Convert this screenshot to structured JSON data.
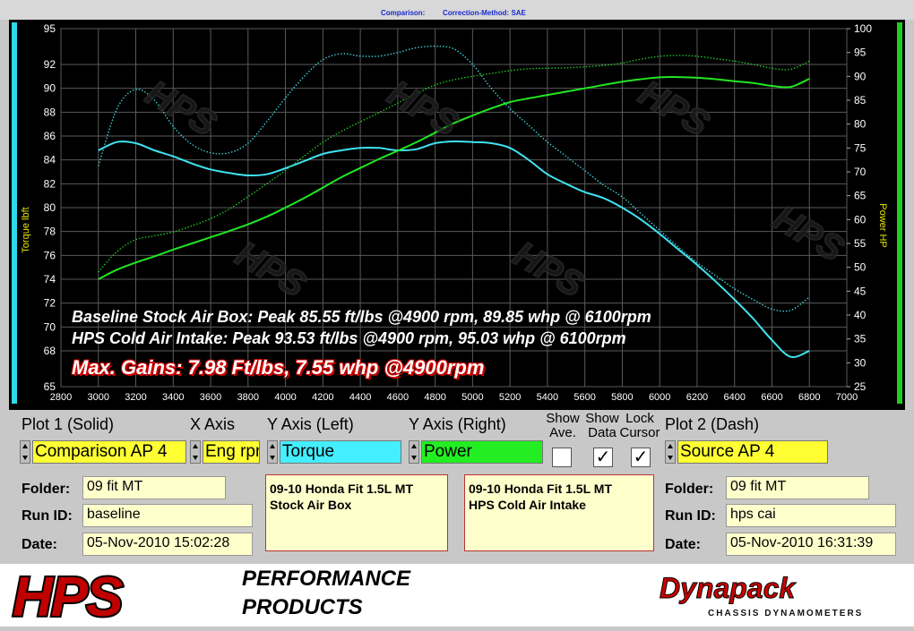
{
  "header": {
    "comparison_label": "Comparison:",
    "correction_label": "Correction-Method: SAE"
  },
  "chart_data": {
    "type": "line",
    "x": [
      3000,
      3100,
      3200,
      3300,
      3400,
      3500,
      3600,
      3700,
      3800,
      3900,
      4000,
      4100,
      4200,
      4300,
      4400,
      4500,
      4600,
      4700,
      4800,
      4900,
      5000,
      5100,
      5200,
      5300,
      5400,
      5500,
      5600,
      5700,
      5800,
      5900,
      6000,
      6100,
      6200,
      6300,
      6400,
      6500,
      6600,
      6700,
      6800
    ],
    "xlim": [
      2800,
      7000
    ],
    "x_ticks": [
      "2800",
      "3000",
      "3200",
      "3400",
      "3600",
      "3800",
      "4000",
      "4200",
      "4400",
      "4600",
      "4800",
      "5000",
      "5200",
      "5400",
      "5600",
      "5800",
      "6000",
      "6200",
      "6400",
      "6600",
      "6800",
      "7000"
    ],
    "ylabel": "Torque lbft",
    "ylim": [
      65,
      95
    ],
    "y_ticks": [
      "65",
      "68",
      "70",
      "72",
      "74",
      "76",
      "78",
      "80",
      "82",
      "84",
      "86",
      "88",
      "90",
      "92",
      "95"
    ],
    "y2label": "Power HP",
    "y2lim": [
      25,
      100
    ],
    "y2_ticks": [
      "25",
      "30",
      "35",
      "40",
      "45",
      "50",
      "55",
      "60",
      "65",
      "70",
      "75",
      "80",
      "85",
      "90",
      "95",
      "100"
    ],
    "grid": true,
    "series": [
      {
        "axis": "left",
        "style": "solid",
        "color": "#3fe3f0",
        "values": [
          84.8,
          85.5,
          85.4,
          84.8,
          84.3,
          83.7,
          83.2,
          82.9,
          82.7,
          82.8,
          83.3,
          83.9,
          84.5,
          84.8,
          85.0,
          85.0,
          84.8,
          84.9,
          85.4,
          85.55,
          85.5,
          85.4,
          85.0,
          84.0,
          82.8,
          82.0,
          81.3,
          80.8,
          80.0,
          79.0,
          77.8,
          76.5,
          75.2,
          73.8,
          72.3,
          70.7,
          68.9,
          67.5,
          68.0
        ]
      },
      {
        "axis": "right",
        "style": "solid",
        "color": "#22e622",
        "values": [
          47.5,
          49.5,
          51.0,
          52.3,
          53.7,
          55.0,
          56.3,
          57.6,
          59.0,
          60.6,
          62.5,
          64.5,
          66.7,
          68.9,
          70.8,
          72.7,
          74.4,
          76.2,
          78.2,
          80.2,
          81.8,
          83.3,
          84.6,
          85.4,
          86.1,
          86.8,
          87.5,
          88.2,
          88.9,
          89.4,
          89.8,
          89.85,
          89.7,
          89.4,
          89.0,
          88.6,
          88.0,
          87.8,
          89.5
        ]
      },
      {
        "axis": "left",
        "style": "dotted",
        "color": "#3fd8e0",
        "values": [
          83.5,
          88.3,
          89.9,
          89.0,
          86.8,
          85.3,
          84.6,
          84.6,
          85.4,
          87.2,
          89.2,
          91.0,
          92.4,
          92.9,
          92.7,
          92.7,
          93.0,
          93.4,
          93.53,
          93.3,
          92.0,
          90.0,
          88.3,
          86.9,
          85.5,
          84.3,
          83.1,
          81.9,
          80.9,
          79.5,
          78.1,
          76.7,
          75.4,
          74.3,
          73.2,
          72.3,
          71.5,
          71.4,
          72.5
        ]
      },
      {
        "axis": "right",
        "style": "dotted",
        "color": "#22d022",
        "values": [
          49.0,
          53.3,
          55.8,
          56.6,
          57.4,
          58.7,
          60.2,
          62.2,
          64.8,
          67.5,
          70.3,
          73.3,
          76.2,
          78.5,
          80.5,
          82.4,
          84.4,
          86.4,
          88.2,
          89.3,
          90.0,
          90.6,
          91.2,
          91.6,
          91.7,
          91.8,
          92.0,
          92.3,
          92.8,
          93.6,
          94.2,
          94.4,
          94.2,
          93.7,
          93.2,
          92.5,
          91.7,
          91.5,
          93.2
        ]
      }
    ]
  },
  "annotations": {
    "line1": "Baseline Stock Air Box: Peak 85.55 ft/lbs @4900 rpm, 89.85 whp @ 6100rpm",
    "line2": "HPS Cold Air Intake: Peak 93.53 ft/lbs @4900 rpm, 95.03 whp @ 6100rpm",
    "line3": "Max. Gains:  7.98 Ft/lbs, 7.55 whp @4900rpm"
  },
  "panel": {
    "plot1_label": "Plot 1 (Solid)",
    "xaxis_label": "X Axis",
    "yleft_label": "Y Axis (Left)",
    "yright_label": "Y Axis (Right)",
    "show_ave_label": "Show\nAve.",
    "show_data_label": "Show\nData",
    "lock_cursor_label": "Lock\nCursor",
    "plot2_label": "Plot 2 (Dash)",
    "plot1_value": "Comparison AP 4",
    "xaxis_value": "Eng rpm",
    "yleft_value": "Torque",
    "yright_value": "Power",
    "plot2_value": "Source AP 4",
    "show_ave_checked": "",
    "show_data_checked": "✓",
    "lock_cursor_checked": "✓",
    "folder_label": "Folder:",
    "runid_label": "Run ID:",
    "date_label": "Date:",
    "left_folder": "09 fit MT",
    "left_runid": "baseline",
    "left_date": "05-Nov-2010  15:02:28",
    "note1": "09-10 Honda Fit 1.5L MT\nStock Air Box",
    "note2": "09-10 Honda Fit 1.5L MT\nHPS Cold Air Intake",
    "right_folder": "09 fit MT",
    "right_runid": "hps cai",
    "right_date": "05-Nov-2010  16:31:39"
  },
  "footer": {
    "logo_letters": "HPS",
    "logo_tag1": "PERFORMANCE",
    "logo_tag2": "PRODUCTS",
    "dyno_brand": "Dynapack",
    "dyno_tag": "CHASSIS DYNAMOMETERS"
  }
}
